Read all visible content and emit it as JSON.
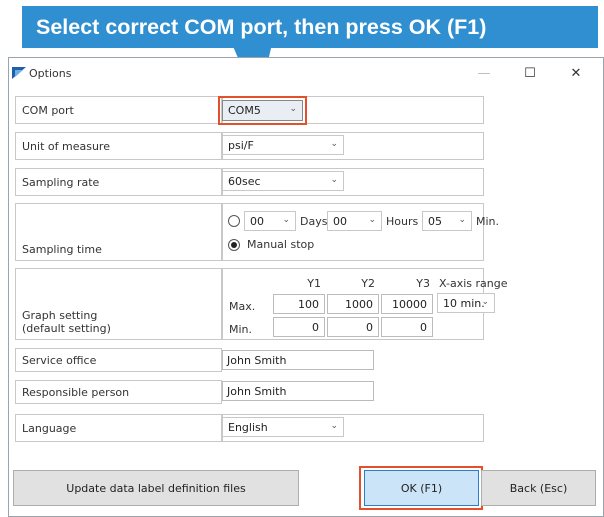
{
  "callout": {
    "text": "Select correct COM port, then press OK (F1)"
  },
  "window": {
    "title": "Options",
    "controls": {
      "minimize": "—",
      "maximize": "☐",
      "close": "✕"
    }
  },
  "form": {
    "com_port": {
      "label": "COM port",
      "value": "COM5"
    },
    "unit": {
      "label": "Unit of measure",
      "value": "psi/F"
    },
    "sampling_rate": {
      "label": "Sampling rate",
      "value": "60sec"
    },
    "sampling_time": {
      "label": "Sampling time",
      "days_value": "00",
      "days_label": "Days",
      "hours_value": "00",
      "hours_label": "Hours",
      "min_value": "05",
      "min_label": "Min.",
      "manual_label": "Manual stop",
      "timed_selected": false,
      "manual_selected": true
    },
    "graph": {
      "label_line1": "Graph setting",
      "label_line2": "(default setting)",
      "columns": [
        "Y1",
        "Y2",
        "Y3"
      ],
      "xaxis_header": "X-axis range",
      "max_label": "Max.",
      "min_label": "Min.",
      "max_values": [
        "100",
        "1000",
        "10000"
      ],
      "min_values": [
        "0",
        "0",
        "0"
      ],
      "xaxis_value": "10 min."
    },
    "service_office": {
      "label": "Service office",
      "value": "John Smith"
    },
    "responsible_person": {
      "label": "Responsible person",
      "value": "John Smith"
    },
    "language": {
      "label": "Language",
      "value": "English"
    }
  },
  "buttons": {
    "update": "Update data label definition files",
    "ok": "OK (F1)",
    "back": "Back (Esc)"
  },
  "colors": {
    "callout": "#2f8fd1",
    "highlight": "#e4502c",
    "ok_button": "#cce4f7"
  },
  "icons": {
    "chevron": "chevron-down-icon",
    "app": "app-logo-icon"
  }
}
